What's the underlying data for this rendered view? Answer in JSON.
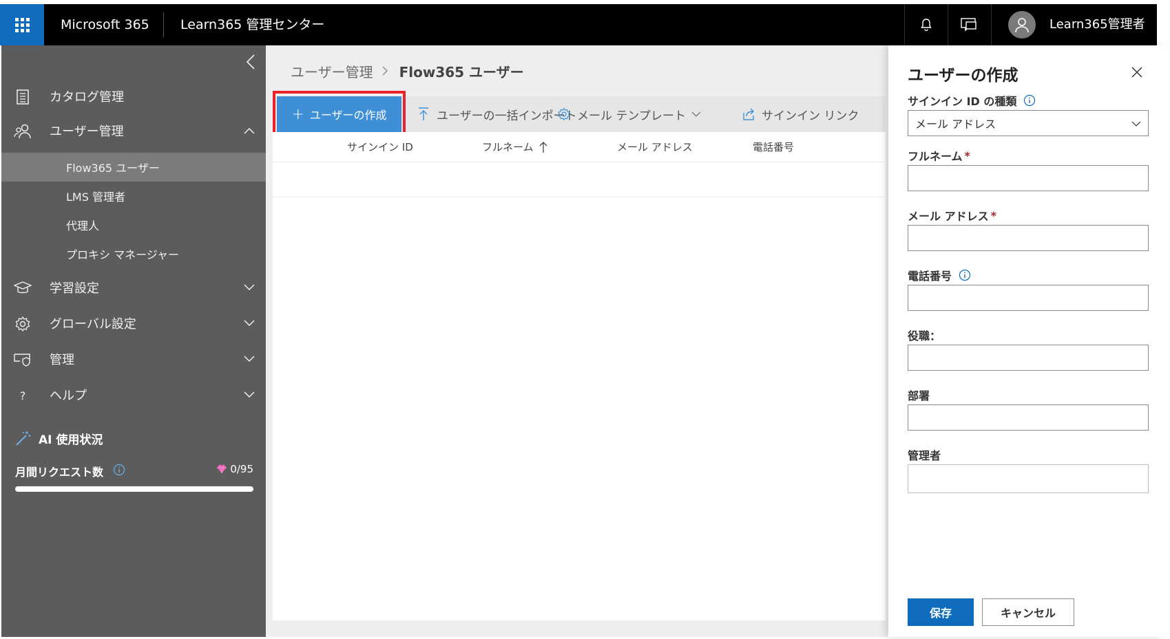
{
  "topbar": {
    "brand": "Microsoft 365",
    "title": "Learn365 管理センター",
    "admin_name": "Learn365管理者",
    "icons": [
      "waffle-icon",
      "bell-icon",
      "feedback-icon",
      "person-icon"
    ]
  },
  "sidebar": {
    "items": [
      {
        "label": "カタログ管理",
        "icon": "catalog-icon"
      },
      {
        "label": "ユーザー管理",
        "icon": "users-icon",
        "expanded": true
      },
      {
        "label": "学習設定",
        "icon": "graduation-cap-icon"
      },
      {
        "label": "グローバル設定",
        "icon": "gear-icon"
      },
      {
        "label": "管理",
        "icon": "shield-icon"
      },
      {
        "label": "ヘルプ",
        "icon": "question-icon"
      }
    ],
    "sub_items": [
      {
        "label": "Flow365 ユーザー",
        "active": true
      },
      {
        "label": "LMS 管理者"
      },
      {
        "label": "代理人"
      },
      {
        "label": "プロキシ マネージャー"
      }
    ],
    "ai_label": "AI 使用状況",
    "requests_label": "月間リクエスト数",
    "requests_count": "0/95",
    "requests_progress": 0
  },
  "main": {
    "breadcrumb": {
      "parent": "ユーザー管理",
      "current": "Flow365 ユーザー"
    },
    "toolbar": {
      "create": "ユーザーの作成",
      "bulk_import": "ユーザーの一括インポート",
      "mail_template": "メール テンプレート",
      "signin_link": "サインイン リンク"
    },
    "columns": [
      "サインイン ID",
      "フルネーム",
      "メール アドレス",
      "電話番号"
    ]
  },
  "panel": {
    "title": "ユーザーの作成",
    "signin_type_label": "サインイン ID の種類",
    "signin_type_value": "メール アドレス",
    "fullname_label": "フルネーム",
    "email_label": "メール アドレス",
    "phone_label": "電話番号",
    "role_label": "役職：",
    "dept_label": "部署",
    "manager_label": "管理者",
    "required_mark": "*",
    "save": "保存",
    "cancel": "キャンセル"
  },
  "colors": {
    "accent": "#0f6cbd",
    "create_button": "#3f8fd6",
    "highlight": "#e8232a",
    "sidebar": "#5c5c5c"
  }
}
